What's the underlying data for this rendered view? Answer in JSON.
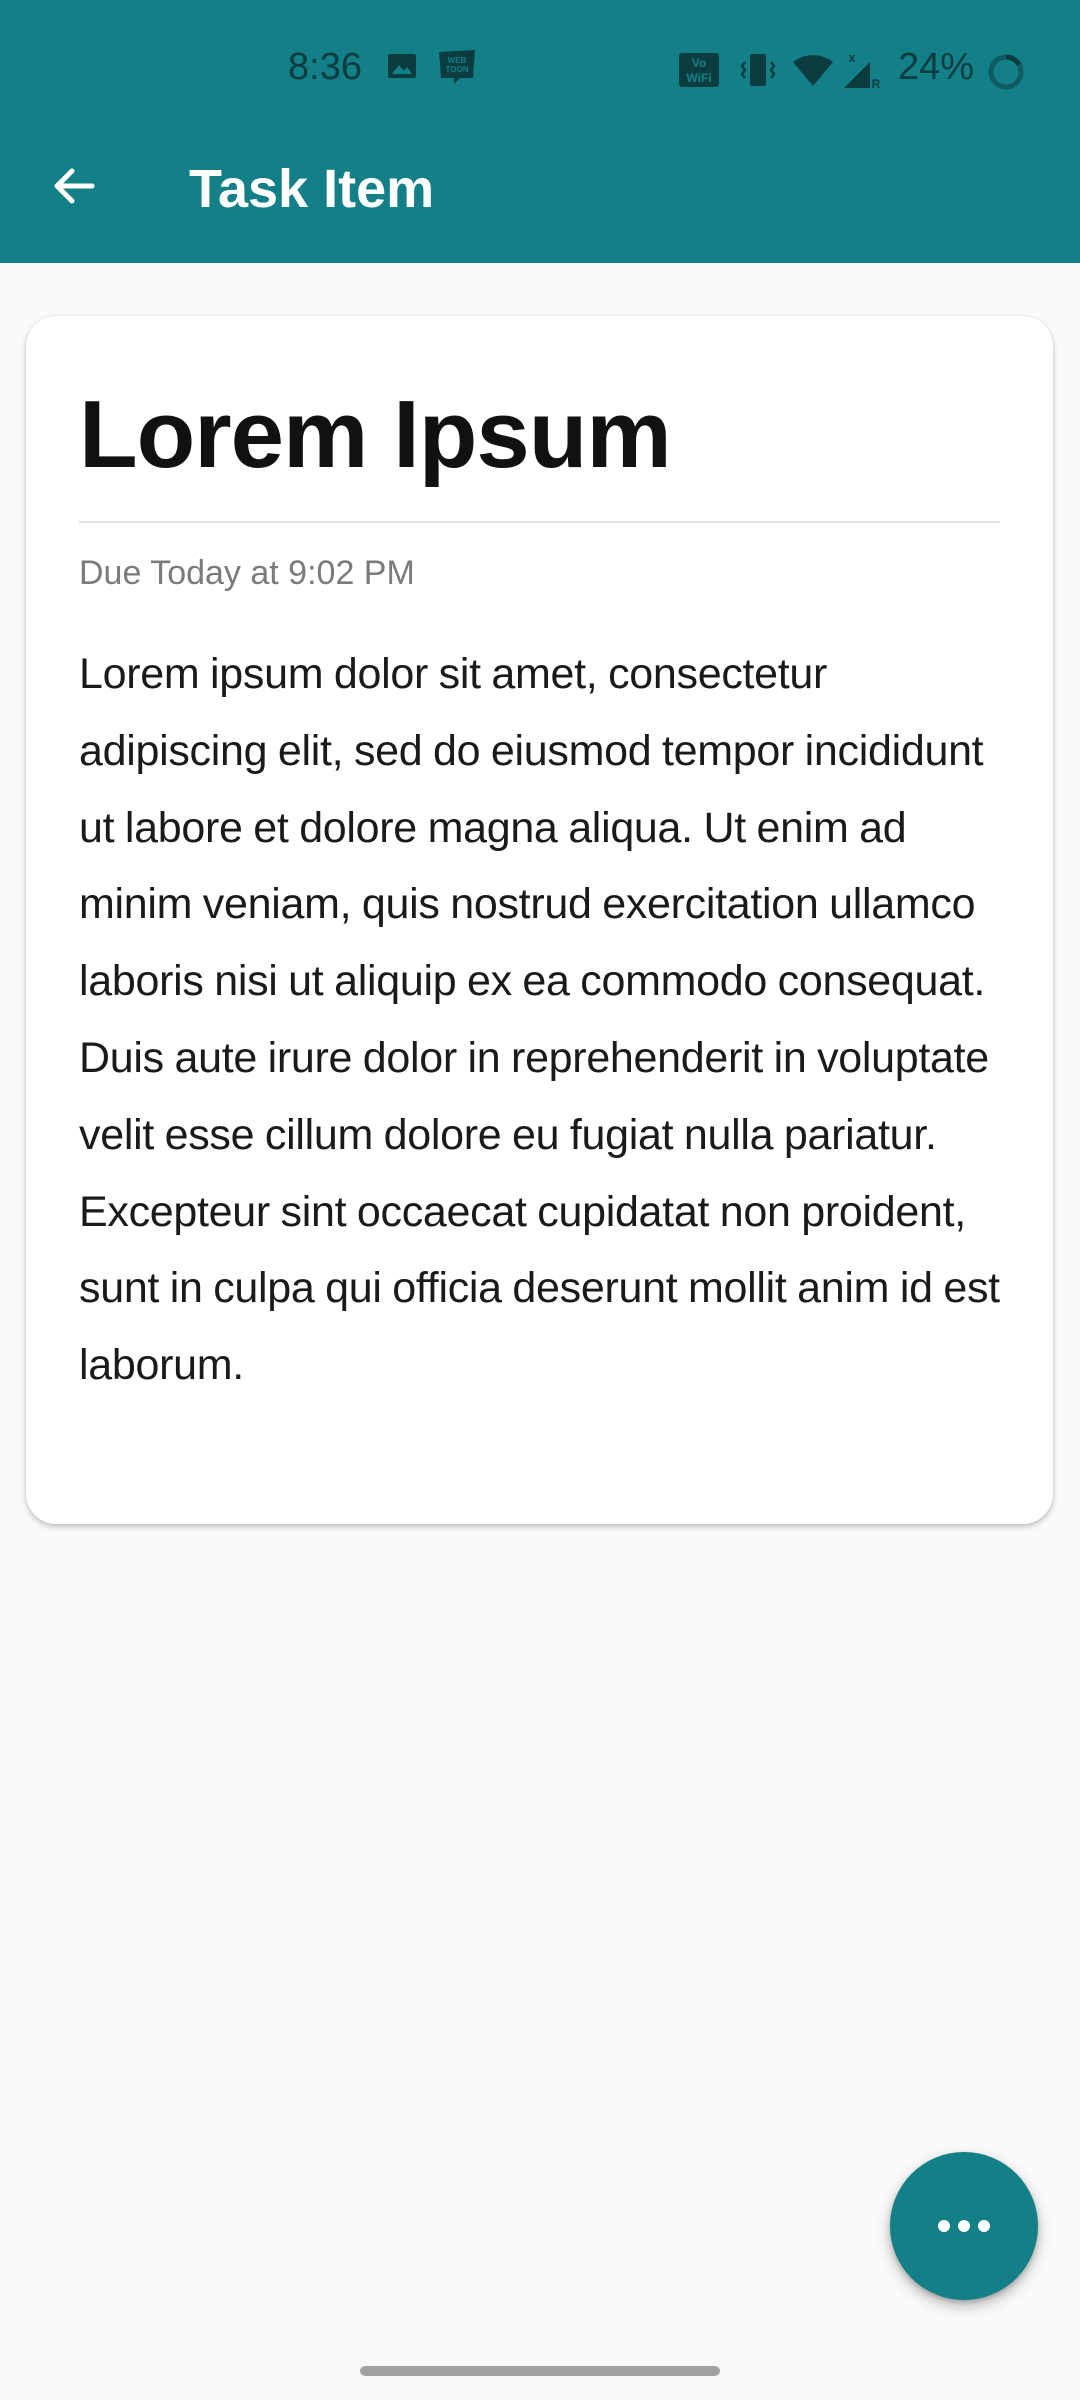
{
  "status_bar": {
    "time": "8:36",
    "battery_percent": "24%",
    "icons": [
      "image-notification-icon",
      "webtoon-notification-icon",
      "vowifi-icon",
      "vibrate-icon",
      "wifi-icon",
      "no-signal-icon",
      "battery-ring-icon"
    ]
  },
  "app_bar": {
    "back_icon": "arrow-back-icon",
    "title": "Task Item"
  },
  "task": {
    "title": "Lorem Ipsum",
    "due": "Due Today at 9:02 PM",
    "description": "Lorem ipsum dolor sit amet, consectetur adipiscing elit, sed do eiusmod tempor incididunt ut labore et dolore magna aliqua. Ut enim ad minim veniam, quis nostrud exercitation ullamco laboris nisi ut aliquip ex ea commodo consequat. Duis aute irure dolor in reprehenderit in voluptate velit esse cillum dolore eu fugiat nulla pariatur. Excepteur sint occaecat cupidatat non proident, sunt in culpa qui officia deserunt mollit anim id est laborum."
  },
  "fab": {
    "icon": "more-horizontal-icon"
  },
  "colors": {
    "primary": "#137f87",
    "background": "#fafafa",
    "card": "#ffffff",
    "status_icons": "#0b3d40"
  }
}
